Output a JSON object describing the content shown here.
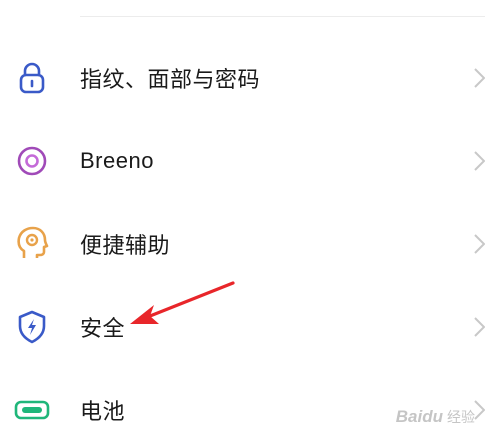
{
  "settings": {
    "items": [
      {
        "label": "指纹、面部与密码",
        "icon": "lock-icon",
        "color": "#3a5ac8"
      },
      {
        "label": "Breeno",
        "icon": "breeno-ring-icon",
        "color": "#a04ab8"
      },
      {
        "label": "便捷辅助",
        "icon": "accessibility-head-icon",
        "color": "#e8a24a"
      },
      {
        "label": "安全",
        "icon": "shield-bolt-icon",
        "color": "#3a5ac8"
      },
      {
        "label": "电池",
        "icon": "battery-icon",
        "color": "#1fb67a"
      }
    ]
  },
  "annotation": {
    "arrow_color": "#e8262a"
  },
  "watermark": {
    "brand": "Baidu",
    "sub": "经验"
  }
}
